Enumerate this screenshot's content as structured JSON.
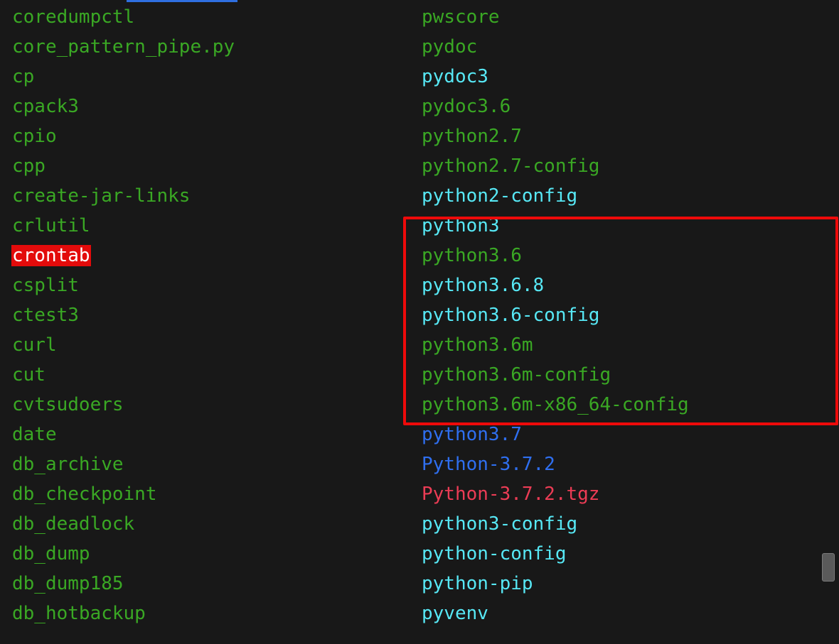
{
  "colors": {
    "background": "#181818",
    "green": "#3aa824",
    "cyan": "#57e8f5",
    "blue": "#2f6ff0",
    "red": "#ec3c55",
    "highlight_border": "#ee0a0a",
    "crontab_bg": "#e30b0b"
  },
  "left_column": [
    {
      "name": "coredumpctl",
      "color": "green"
    },
    {
      "name": "core_pattern_pipe.py",
      "color": "green"
    },
    {
      "name": "cp",
      "color": "green"
    },
    {
      "name": "cpack3",
      "color": "green"
    },
    {
      "name": "cpio",
      "color": "green"
    },
    {
      "name": "cpp",
      "color": "green"
    },
    {
      "name": "create-jar-links",
      "color": "green"
    },
    {
      "name": "crlutil",
      "color": "green"
    },
    {
      "name": "crontab",
      "color": "white-on-red"
    },
    {
      "name": "csplit",
      "color": "green"
    },
    {
      "name": "ctest3",
      "color": "green"
    },
    {
      "name": "curl",
      "color": "green"
    },
    {
      "name": "cut",
      "color": "green"
    },
    {
      "name": "cvtsudoers",
      "color": "green"
    },
    {
      "name": "date",
      "color": "green"
    },
    {
      "name": "db_archive",
      "color": "green"
    },
    {
      "name": "db_checkpoint",
      "color": "green"
    },
    {
      "name": "db_deadlock",
      "color": "green"
    },
    {
      "name": "db_dump",
      "color": "green"
    },
    {
      "name": "db_dump185",
      "color": "green"
    },
    {
      "name": "db_hotbackup",
      "color": "green"
    }
  ],
  "right_column": [
    {
      "name": "pwscore",
      "color": "green"
    },
    {
      "name": "pydoc",
      "color": "green"
    },
    {
      "name": "pydoc3",
      "color": "cyan"
    },
    {
      "name": "pydoc3.6",
      "color": "green"
    },
    {
      "name": "python2.7",
      "color": "green"
    },
    {
      "name": "python2.7-config",
      "color": "green"
    },
    {
      "name": "python2-config",
      "color": "cyan"
    },
    {
      "name": "python3",
      "color": "cyan"
    },
    {
      "name": "python3.6",
      "color": "green"
    },
    {
      "name": "python3.6.8",
      "color": "cyan"
    },
    {
      "name": "python3.6-config",
      "color": "cyan"
    },
    {
      "name": "python3.6m",
      "color": "green"
    },
    {
      "name": "python3.6m-config",
      "color": "green"
    },
    {
      "name": "python3.6m-x86_64-config",
      "color": "green"
    },
    {
      "name": "python3.7",
      "color": "blue"
    },
    {
      "name": "Python-3.7.2",
      "color": "blue"
    },
    {
      "name": "Python-3.7.2.tgz",
      "color": "red"
    },
    {
      "name": "python3-config",
      "color": "cyan"
    },
    {
      "name": "python-config",
      "color": "cyan"
    },
    {
      "name": "python-pip",
      "color": "cyan"
    },
    {
      "name": "pyvenv",
      "color": "cyan"
    }
  ]
}
